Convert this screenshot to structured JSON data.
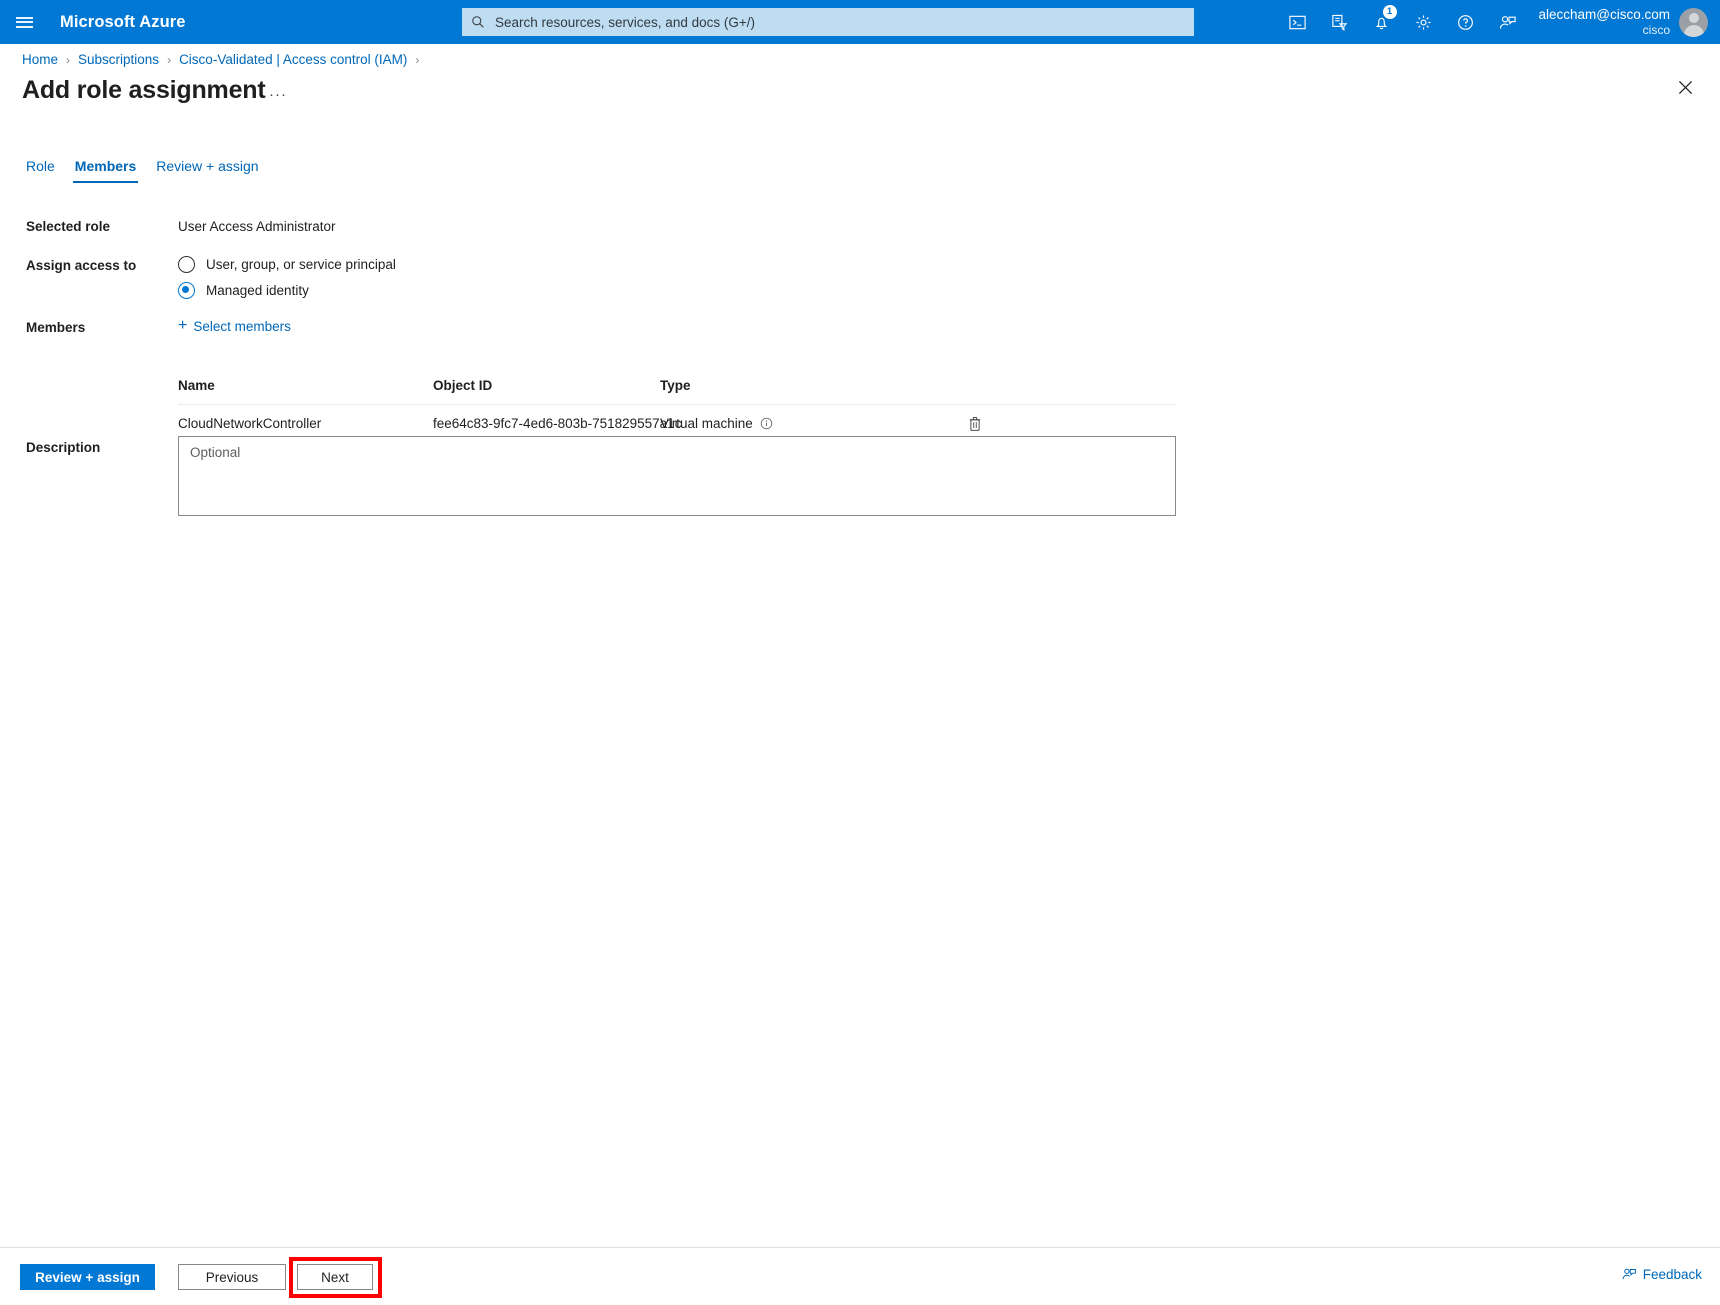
{
  "topbar": {
    "brand": "Microsoft Azure",
    "menu_icon": "hamburger-icon",
    "search": {
      "placeholder": "Search resources, services, and docs (G+/)",
      "value": "",
      "icon": "search-icon"
    },
    "icons": [
      {
        "name": "cloud-shell-icon",
        "label": "Cloud Shell"
      },
      {
        "name": "directories-subscriptions-icon",
        "label": "Directories + subscriptions"
      },
      {
        "name": "notifications-bell-icon",
        "label": "Notifications",
        "badge": "1"
      },
      {
        "name": "settings-gear-icon",
        "label": "Settings"
      },
      {
        "name": "help-question-icon",
        "label": "Help"
      },
      {
        "name": "feedback-person-icon",
        "label": "Feedback"
      }
    ],
    "account": {
      "email": "aleccham@cisco.com",
      "org": "cisco",
      "avatar": "user-avatar"
    }
  },
  "breadcrumb": {
    "items": [
      "Home",
      "Subscriptions",
      "Cisco-Validated | Access control (IAM)"
    ],
    "separator": "›",
    "trailing_separator": "›"
  },
  "header": {
    "title": "Add role assignment",
    "ellipsis": "···",
    "close_icon": "close-icon"
  },
  "tabs": [
    {
      "label": "Role",
      "active": false
    },
    {
      "label": "Members",
      "active": true
    },
    {
      "label": "Review + assign",
      "active": false
    }
  ],
  "form": {
    "selected_role": {
      "label": "Selected role",
      "value": "User Access Administrator"
    },
    "assign_access_to": {
      "label": "Assign access to",
      "options": [
        {
          "label": "User, group, or service principal",
          "selected": false
        },
        {
          "label": "Managed identity",
          "selected": true
        }
      ]
    },
    "members": {
      "label": "Members",
      "select_link": "Select members",
      "plus_icon": "plus-icon"
    },
    "description": {
      "label": "Description",
      "placeholder": "Optional",
      "value": ""
    }
  },
  "members_table": {
    "columns": [
      "Name",
      "Object ID",
      "Type"
    ],
    "rows": [
      {
        "name": "CloudNetworkController",
        "object_id": "fee64c83-9fc7-4ed6-803b-751829557a1c",
        "type": "Virtual machine",
        "type_info_icon": "info-icon",
        "delete_icon": "trash-icon"
      }
    ]
  },
  "footer": {
    "review_assign": "Review + assign",
    "previous": "Previous",
    "next": "Next",
    "feedback": "Feedback",
    "feedback_icon": "feedback-person-icon",
    "highlight_color": "#ff0000",
    "highlighted_button": "Next"
  },
  "colors": {
    "azure_blue": "#0078d4",
    "link_blue": "#0067b8",
    "search_bg": "#bfddf2",
    "highlight_red": "#ff0000",
    "text": "#201f1e"
  }
}
